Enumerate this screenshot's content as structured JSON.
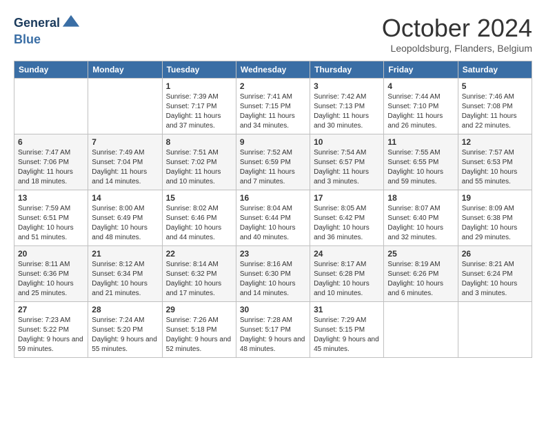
{
  "header": {
    "logo_line1": "General",
    "logo_line2": "Blue",
    "month_title": "October 2024",
    "location": "Leopoldsburg, Flanders, Belgium"
  },
  "days_of_week": [
    "Sunday",
    "Monday",
    "Tuesday",
    "Wednesday",
    "Thursday",
    "Friday",
    "Saturday"
  ],
  "weeks": [
    [
      {
        "day": "",
        "sunrise": "",
        "sunset": "",
        "daylight": ""
      },
      {
        "day": "",
        "sunrise": "",
        "sunset": "",
        "daylight": ""
      },
      {
        "day": "1",
        "sunrise": "Sunrise: 7:39 AM",
        "sunset": "Sunset: 7:17 PM",
        "daylight": "Daylight: 11 hours and 37 minutes."
      },
      {
        "day": "2",
        "sunrise": "Sunrise: 7:41 AM",
        "sunset": "Sunset: 7:15 PM",
        "daylight": "Daylight: 11 hours and 34 minutes."
      },
      {
        "day": "3",
        "sunrise": "Sunrise: 7:42 AM",
        "sunset": "Sunset: 7:13 PM",
        "daylight": "Daylight: 11 hours and 30 minutes."
      },
      {
        "day": "4",
        "sunrise": "Sunrise: 7:44 AM",
        "sunset": "Sunset: 7:10 PM",
        "daylight": "Daylight: 11 hours and 26 minutes."
      },
      {
        "day": "5",
        "sunrise": "Sunrise: 7:46 AM",
        "sunset": "Sunset: 7:08 PM",
        "daylight": "Daylight: 11 hours and 22 minutes."
      }
    ],
    [
      {
        "day": "6",
        "sunrise": "Sunrise: 7:47 AM",
        "sunset": "Sunset: 7:06 PM",
        "daylight": "Daylight: 11 hours and 18 minutes."
      },
      {
        "day": "7",
        "sunrise": "Sunrise: 7:49 AM",
        "sunset": "Sunset: 7:04 PM",
        "daylight": "Daylight: 11 hours and 14 minutes."
      },
      {
        "day": "8",
        "sunrise": "Sunrise: 7:51 AM",
        "sunset": "Sunset: 7:02 PM",
        "daylight": "Daylight: 11 hours and 10 minutes."
      },
      {
        "day": "9",
        "sunrise": "Sunrise: 7:52 AM",
        "sunset": "Sunset: 6:59 PM",
        "daylight": "Daylight: 11 hours and 7 minutes."
      },
      {
        "day": "10",
        "sunrise": "Sunrise: 7:54 AM",
        "sunset": "Sunset: 6:57 PM",
        "daylight": "Daylight: 11 hours and 3 minutes."
      },
      {
        "day": "11",
        "sunrise": "Sunrise: 7:55 AM",
        "sunset": "Sunset: 6:55 PM",
        "daylight": "Daylight: 10 hours and 59 minutes."
      },
      {
        "day": "12",
        "sunrise": "Sunrise: 7:57 AM",
        "sunset": "Sunset: 6:53 PM",
        "daylight": "Daylight: 10 hours and 55 minutes."
      }
    ],
    [
      {
        "day": "13",
        "sunrise": "Sunrise: 7:59 AM",
        "sunset": "Sunset: 6:51 PM",
        "daylight": "Daylight: 10 hours and 51 minutes."
      },
      {
        "day": "14",
        "sunrise": "Sunrise: 8:00 AM",
        "sunset": "Sunset: 6:49 PM",
        "daylight": "Daylight: 10 hours and 48 minutes."
      },
      {
        "day": "15",
        "sunrise": "Sunrise: 8:02 AM",
        "sunset": "Sunset: 6:46 PM",
        "daylight": "Daylight: 10 hours and 44 minutes."
      },
      {
        "day": "16",
        "sunrise": "Sunrise: 8:04 AM",
        "sunset": "Sunset: 6:44 PM",
        "daylight": "Daylight: 10 hours and 40 minutes."
      },
      {
        "day": "17",
        "sunrise": "Sunrise: 8:05 AM",
        "sunset": "Sunset: 6:42 PM",
        "daylight": "Daylight: 10 hours and 36 minutes."
      },
      {
        "day": "18",
        "sunrise": "Sunrise: 8:07 AM",
        "sunset": "Sunset: 6:40 PM",
        "daylight": "Daylight: 10 hours and 32 minutes."
      },
      {
        "day": "19",
        "sunrise": "Sunrise: 8:09 AM",
        "sunset": "Sunset: 6:38 PM",
        "daylight": "Daylight: 10 hours and 29 minutes."
      }
    ],
    [
      {
        "day": "20",
        "sunrise": "Sunrise: 8:11 AM",
        "sunset": "Sunset: 6:36 PM",
        "daylight": "Daylight: 10 hours and 25 minutes."
      },
      {
        "day": "21",
        "sunrise": "Sunrise: 8:12 AM",
        "sunset": "Sunset: 6:34 PM",
        "daylight": "Daylight: 10 hours and 21 minutes."
      },
      {
        "day": "22",
        "sunrise": "Sunrise: 8:14 AM",
        "sunset": "Sunset: 6:32 PM",
        "daylight": "Daylight: 10 hours and 17 minutes."
      },
      {
        "day": "23",
        "sunrise": "Sunrise: 8:16 AM",
        "sunset": "Sunset: 6:30 PM",
        "daylight": "Daylight: 10 hours and 14 minutes."
      },
      {
        "day": "24",
        "sunrise": "Sunrise: 8:17 AM",
        "sunset": "Sunset: 6:28 PM",
        "daylight": "Daylight: 10 hours and 10 minutes."
      },
      {
        "day": "25",
        "sunrise": "Sunrise: 8:19 AM",
        "sunset": "Sunset: 6:26 PM",
        "daylight": "Daylight: 10 hours and 6 minutes."
      },
      {
        "day": "26",
        "sunrise": "Sunrise: 8:21 AM",
        "sunset": "Sunset: 6:24 PM",
        "daylight": "Daylight: 10 hours and 3 minutes."
      }
    ],
    [
      {
        "day": "27",
        "sunrise": "Sunrise: 7:23 AM",
        "sunset": "Sunset: 5:22 PM",
        "daylight": "Daylight: 9 hours and 59 minutes."
      },
      {
        "day": "28",
        "sunrise": "Sunrise: 7:24 AM",
        "sunset": "Sunset: 5:20 PM",
        "daylight": "Daylight: 9 hours and 55 minutes."
      },
      {
        "day": "29",
        "sunrise": "Sunrise: 7:26 AM",
        "sunset": "Sunset: 5:18 PM",
        "daylight": "Daylight: 9 hours and 52 minutes."
      },
      {
        "day": "30",
        "sunrise": "Sunrise: 7:28 AM",
        "sunset": "Sunset: 5:17 PM",
        "daylight": "Daylight: 9 hours and 48 minutes."
      },
      {
        "day": "31",
        "sunrise": "Sunrise: 7:29 AM",
        "sunset": "Sunset: 5:15 PM",
        "daylight": "Daylight: 9 hours and 45 minutes."
      },
      {
        "day": "",
        "sunrise": "",
        "sunset": "",
        "daylight": ""
      },
      {
        "day": "",
        "sunrise": "",
        "sunset": "",
        "daylight": ""
      }
    ]
  ]
}
